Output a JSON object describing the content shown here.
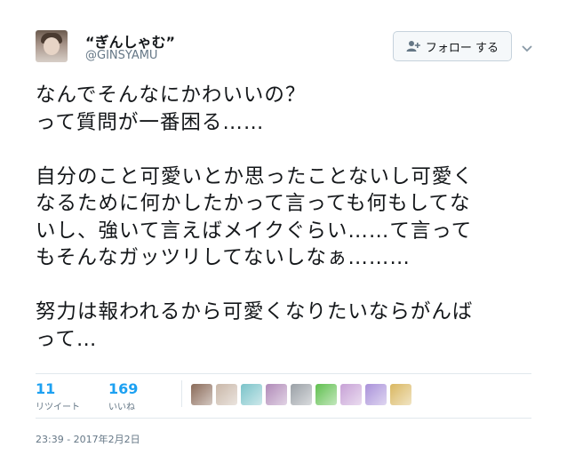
{
  "user": {
    "display_name": "“ぎんしゃむ”",
    "handle": "@GINSYAMU"
  },
  "follow_button": {
    "label": "フォロー する",
    "icon": "person-plus-icon"
  },
  "menu_icon": "chevron-down-icon",
  "tweet": {
    "lines": [
      "なんでそんなにかわいいの？",
      "って質問が一番困る……",
      "",
      "自分のこと可愛いとか思ったことないし可愛く",
      "なるために何かしたかって言っても何もしてな",
      "いし、強いて言えばメイクぐらい……て言って",
      "もそんなガッツリしてないしなぁ………",
      "",
      "努力は報われるから可愛くなりたいならがんば",
      "って…"
    ]
  },
  "stats": {
    "retweets": {
      "count": "11",
      "label": "リツイート"
    },
    "likes": {
      "count": "169",
      "label": "いいね"
    }
  },
  "liker_avatar_colors": [
    "#8a6a58",
    "#c9b7a8",
    "#7ac3c9",
    "#b08ab8",
    "#9aa0a6",
    "#5fbf4e",
    "#c7a1d6",
    "#a991d9",
    "#d9b760"
  ],
  "timestamp": "23:39 - 2017年2月2日",
  "colors": {
    "accent": "#1da1f2",
    "secondary_text": "#657786",
    "border": "#e1e8ed"
  }
}
